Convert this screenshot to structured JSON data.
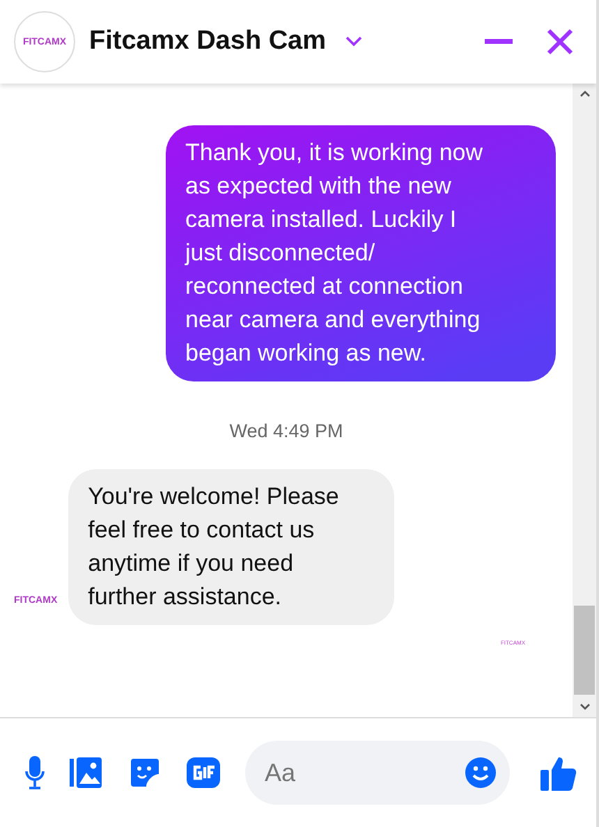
{
  "header": {
    "avatar_text": "FITCAMX",
    "title": "Fitcamx Dash Cam"
  },
  "messages": [
    {
      "kind": "outgoing",
      "text": "Thank you, it is working now\nas expected with the new\ncamera installed. Luckily I\njust disconnected/\nreconnected at connection\nnear camera and everything\nbegan working as new."
    },
    {
      "kind": "timestamp",
      "text": "Wed 4:49 PM"
    },
    {
      "kind": "incoming",
      "text": "You're welcome! Please\nfeel free to contact us\nanytime if you need\nfurther assistance.",
      "avatar_text": "FITCAMX"
    }
  ],
  "seen_avatar_text": "FITCAMX",
  "composer": {
    "placeholder": "Aa"
  }
}
